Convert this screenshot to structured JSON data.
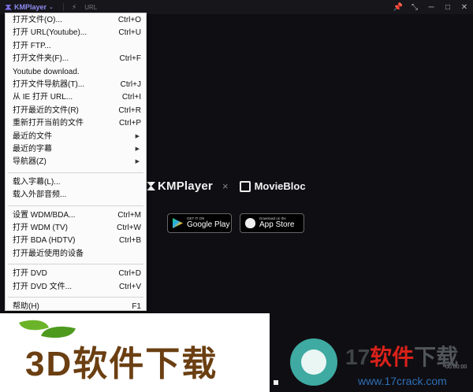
{
  "titlebar": {
    "logo_text": "KMPlayer",
    "caret": "⌄",
    "bolt_icon": "⚡",
    "url_label": "URL",
    "controls": [
      "pin-icon",
      "shrink-icon",
      "minimize-icon",
      "maximize-icon",
      "close-icon"
    ],
    "control_glyphs": [
      "📌",
      "⤡",
      "─",
      "□",
      "✕"
    ]
  },
  "menu": {
    "groups": [
      [
        {
          "label": "打开文件(O)...",
          "shortcut": "Ctrl+O"
        },
        {
          "label": "打开 URL(Youtube)...",
          "shortcut": "Ctrl+U"
        },
        {
          "label": "打开 FTP...",
          "shortcut": ""
        },
        {
          "label": "打开文件夹(F)...",
          "shortcut": "Ctrl+F"
        },
        {
          "label": "Youtube download.",
          "shortcut": ""
        },
        {
          "label": "打开文件导航器(T)...",
          "shortcut": "Ctrl+J"
        },
        {
          "label": "从 IE 打开 URL...",
          "shortcut": "Ctrl+I"
        },
        {
          "label": "打开最近的文件(R)",
          "shortcut": "Ctrl+R"
        },
        {
          "label": "重新打开当前的文件",
          "shortcut": "Ctrl+P"
        },
        {
          "label": "最近的文件",
          "shortcut": "",
          "submenu": true
        },
        {
          "label": "最近的字幕",
          "shortcut": "",
          "submenu": true
        },
        {
          "label": "导航器(Z)",
          "shortcut": "",
          "submenu": true
        }
      ],
      [
        {
          "label": "载入字幕(L)...",
          "shortcut": ""
        },
        {
          "label": "载入外部音频...",
          "shortcut": ""
        }
      ],
      [
        {
          "label": "设置 WDM/BDA...",
          "shortcut": "Ctrl+M"
        },
        {
          "label": "打开 WDM (TV)",
          "shortcut": "Ctrl+W"
        },
        {
          "label": "打开 BDA (HDTV)",
          "shortcut": "Ctrl+B"
        },
        {
          "label": "打开最近使用的设备",
          "shortcut": ""
        }
      ],
      [
        {
          "label": "打开 DVD",
          "shortcut": "Ctrl+D"
        },
        {
          "label": "打开 DVD 文件...",
          "shortcut": "Ctrl+V"
        }
      ],
      [
        {
          "label": "帮助(H)",
          "shortcut": "F1"
        }
      ]
    ],
    "submenu_arrow": "▶"
  },
  "splash": {
    "kmplayer_brand": "KMPlayer",
    "times": "×",
    "moviebloc_brand": "MovieBloc",
    "google_play": {
      "small": "GET IT ON",
      "big": "Google Play"
    },
    "app_store": {
      "small": "Download on the",
      "big": "App Store"
    }
  },
  "playback": {
    "time": "00:00:00"
  },
  "watermark": {
    "left_text": "3D软件下载",
    "right_num": "17",
    "right_red": "软件",
    "right_grey": "下载",
    "right_url": "www.17crack.com"
  },
  "colors": {
    "background": "#111015",
    "menu_bg": "#fbfbfb",
    "accent": "#7a70e8",
    "watermark_brown": "#6b3f12",
    "watermark_red": "#d9221a",
    "watermark_blue": "#2f6fb5"
  }
}
